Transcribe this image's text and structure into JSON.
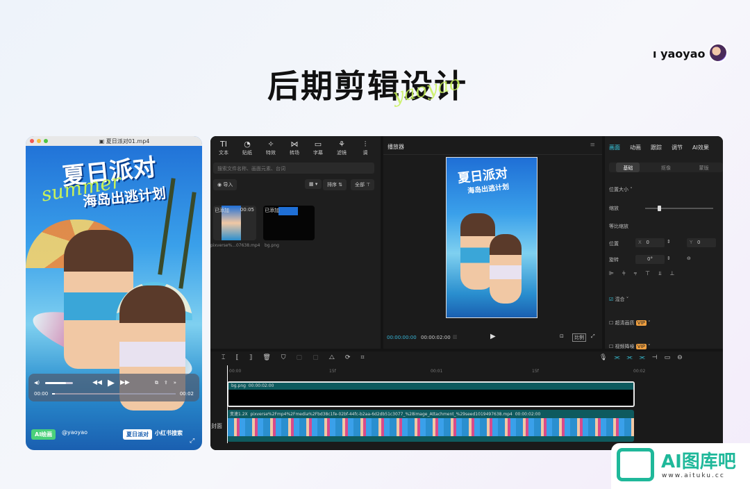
{
  "header": {
    "title": "后期剪辑设计",
    "script": "yaoyao",
    "author": "yaoyao"
  },
  "phone": {
    "window_title": "夏日派对01.mp4",
    "poster_title": "夏日派对",
    "poster_subtitle": "海岛出逃计划",
    "poster_script": "summer",
    "time_current": "00:00",
    "time_total": "00:02",
    "progress": 0.02,
    "tag_ai": "AI绘画",
    "tag_user": "@yaoyao",
    "tag_box": "夏日派对",
    "tag_search": "小红书搜索"
  },
  "editor": {
    "tools": [
      {
        "icon": "TI",
        "label": "文本"
      },
      {
        "icon": "◔",
        "label": "贴纸"
      },
      {
        "icon": "✧",
        "label": "特效"
      },
      {
        "icon": "⋈",
        "label": "转场"
      },
      {
        "icon": "▭",
        "label": "字幕"
      },
      {
        "icon": "⚘",
        "label": "滤镜"
      },
      {
        "icon": "⫶",
        "label": "调"
      }
    ],
    "search_placeholder": "搜索文件名称、画面元素、台词",
    "import_label": "导入",
    "sort_label": "排序",
    "filter_label": "全部",
    "media": [
      {
        "badge": "已添加",
        "duration": "00:05",
        "name": "pixverse%...07638.mp4"
      },
      {
        "badge": "已添加",
        "duration": "",
        "name": "bg.png"
      }
    ],
    "player_title": "播放器",
    "player_time_current": "00:00:00:00",
    "player_time_total": "00:00:02:00",
    "ratio_label": "比例",
    "right_tabs": [
      "画面",
      "动画",
      "跟踪",
      "调节",
      "AI效果"
    ],
    "sub_tabs": [
      "基础",
      "抠像",
      "蒙版"
    ],
    "props": {
      "section_position": "位置大小",
      "scale": "缩放",
      "uniform_scale": "等比缩放",
      "position": "位置",
      "x_label": "X",
      "x_value": "0",
      "y_label": "Y",
      "y_value": "0",
      "rotation": "旋转",
      "rotation_value": "0°",
      "blend": "混合",
      "hd": "超清画质",
      "denoise": "视频降噪",
      "vip": "VIP"
    },
    "ruler": [
      "00:00",
      "15f",
      "00:01",
      "15f",
      "00:02"
    ],
    "track1": {
      "name": "bg.png",
      "duration": "00:00:02:00"
    },
    "track2": {
      "speed": "变速1.2X",
      "name": "pixverse%2Fmp4%2Fmedia%2Fbd38c1fe-02bf-44fc-b2aa-6d2db51c3077_%28image_Attachment_%29seed1019497638.mp4",
      "duration": "00:00:02:00"
    },
    "cover_label": "封面"
  },
  "logo": {
    "text": "AI图库吧",
    "url": "www.aituku.cc"
  },
  "colors": {
    "accent": "#3ad0e8",
    "brand": "#1fb89a",
    "track": "#0e5a5e"
  }
}
